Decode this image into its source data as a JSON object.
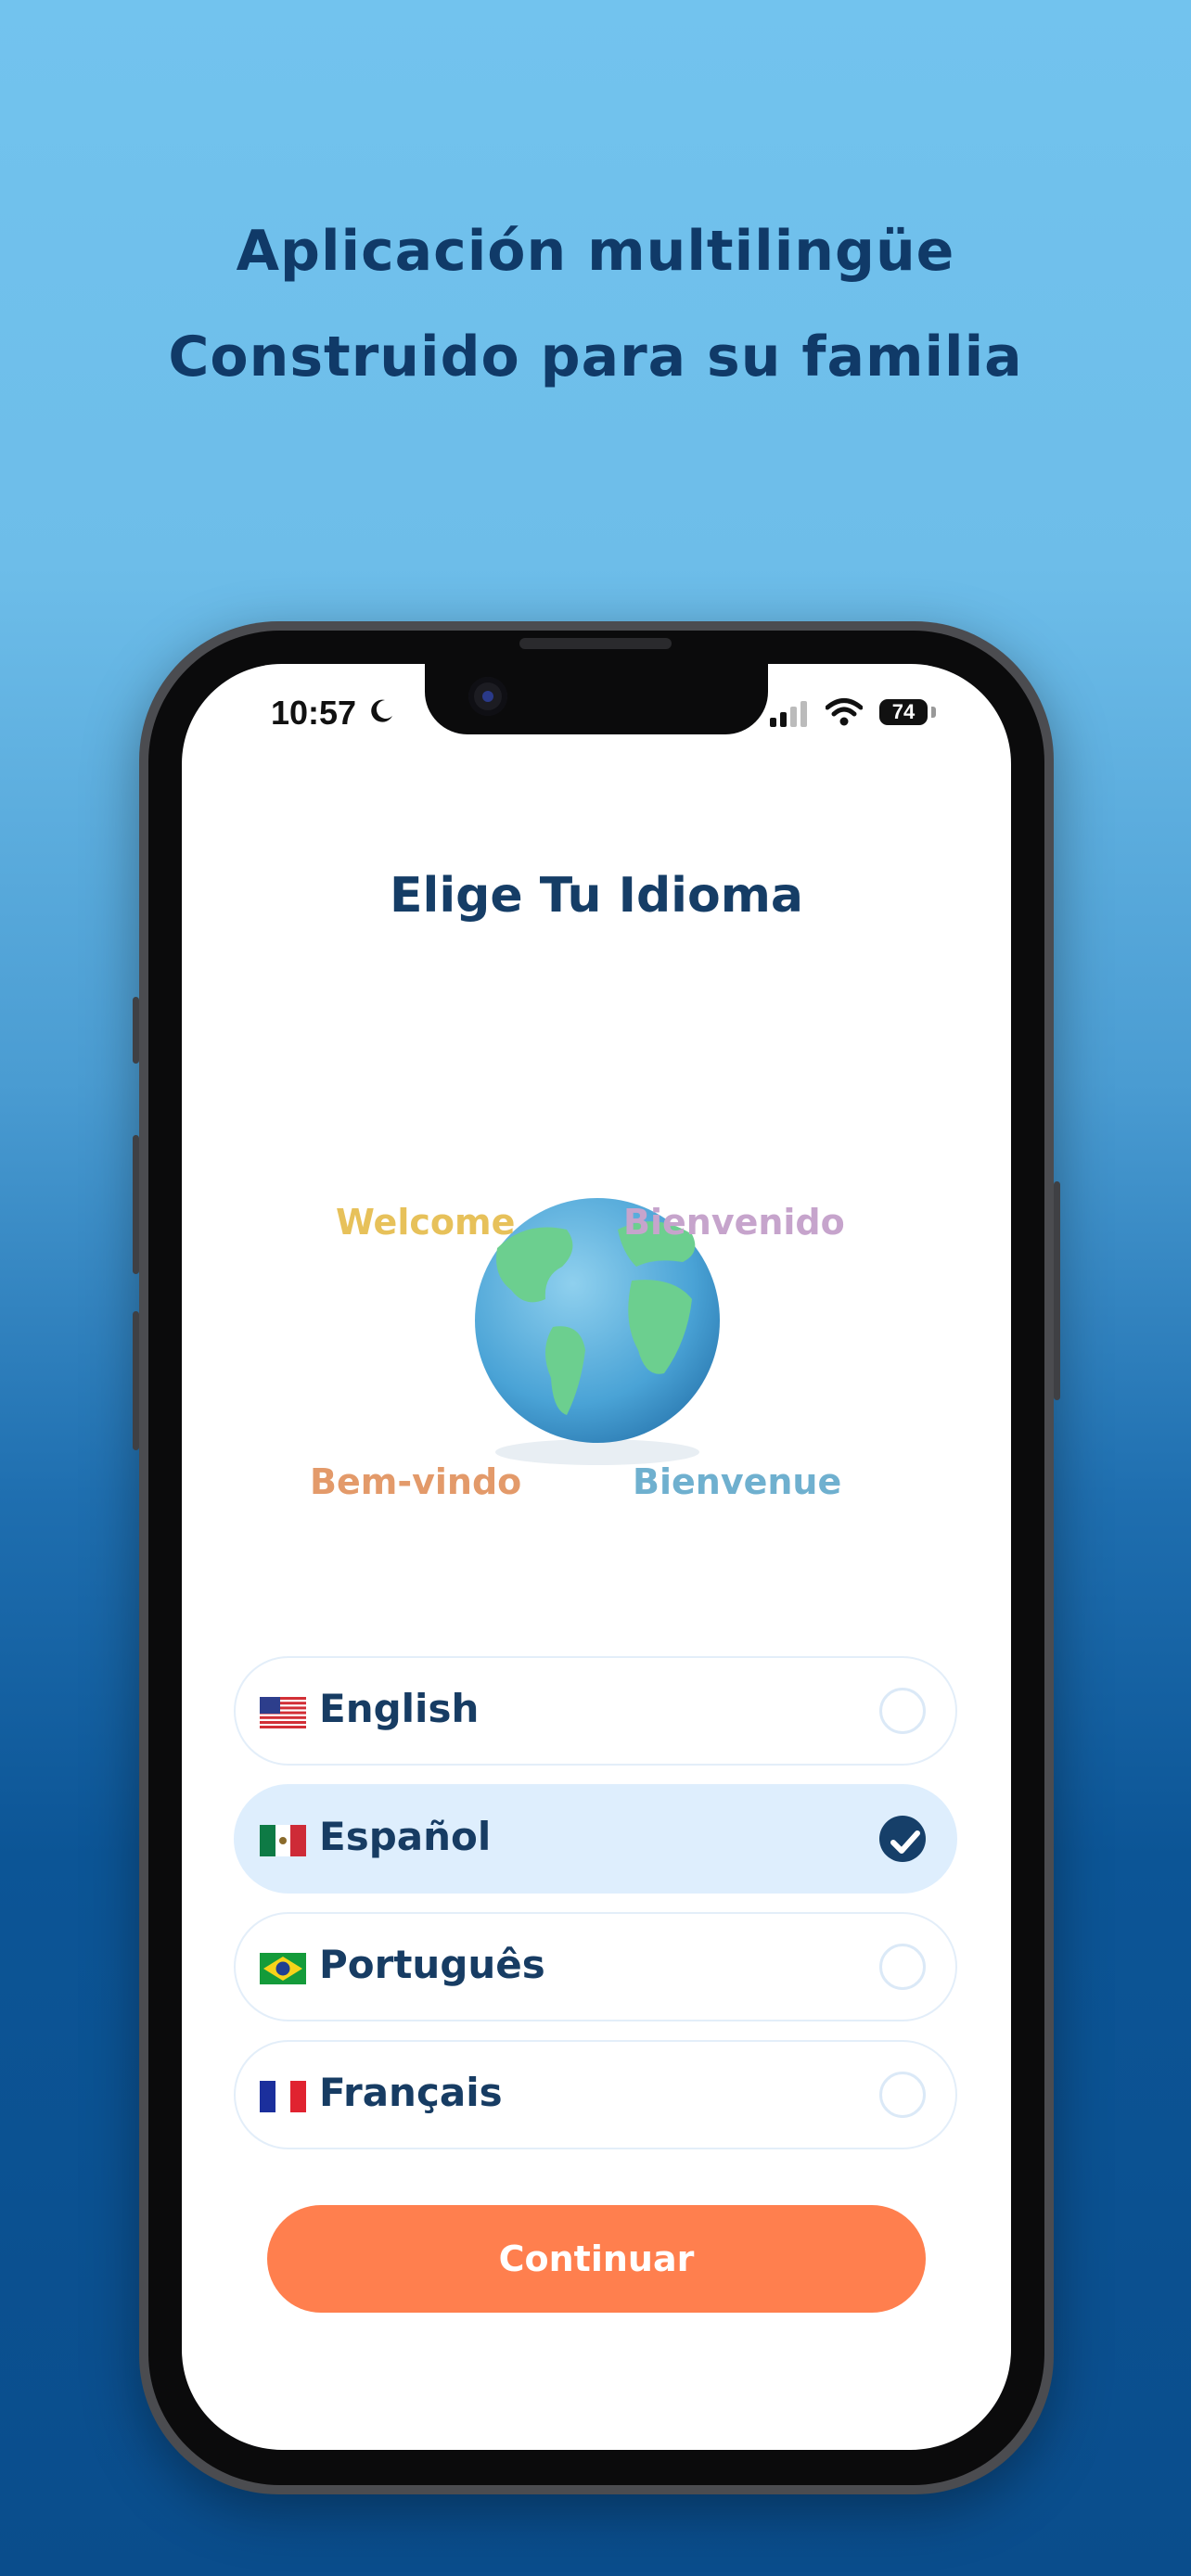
{
  "promo": {
    "headline_line1": "Aplicación multilingüe",
    "headline_line2": "Construido para su familia"
  },
  "status_bar": {
    "time": "10:57",
    "battery": "74"
  },
  "screen": {
    "title": "Elige Tu Idioma",
    "globe_words": {
      "welcome": "Welcome",
      "bienvenido": "Bienvenido",
      "bem_vindo": "Bem-vindo",
      "bienvenue": "Bienvenue"
    },
    "languages": [
      {
        "label": "English",
        "flag": "us-flag",
        "selected": false
      },
      {
        "label": "Español",
        "flag": "mx-flag",
        "selected": true
      },
      {
        "label": "Português",
        "flag": "br-flag",
        "selected": false
      },
      {
        "label": "Français",
        "flag": "fr-flag",
        "selected": false
      }
    ],
    "continue_label": "Continuar"
  },
  "colors": {
    "primary_text": "#153d66",
    "selected_bg": "#deeefd",
    "accent": "#ff7f4e"
  }
}
